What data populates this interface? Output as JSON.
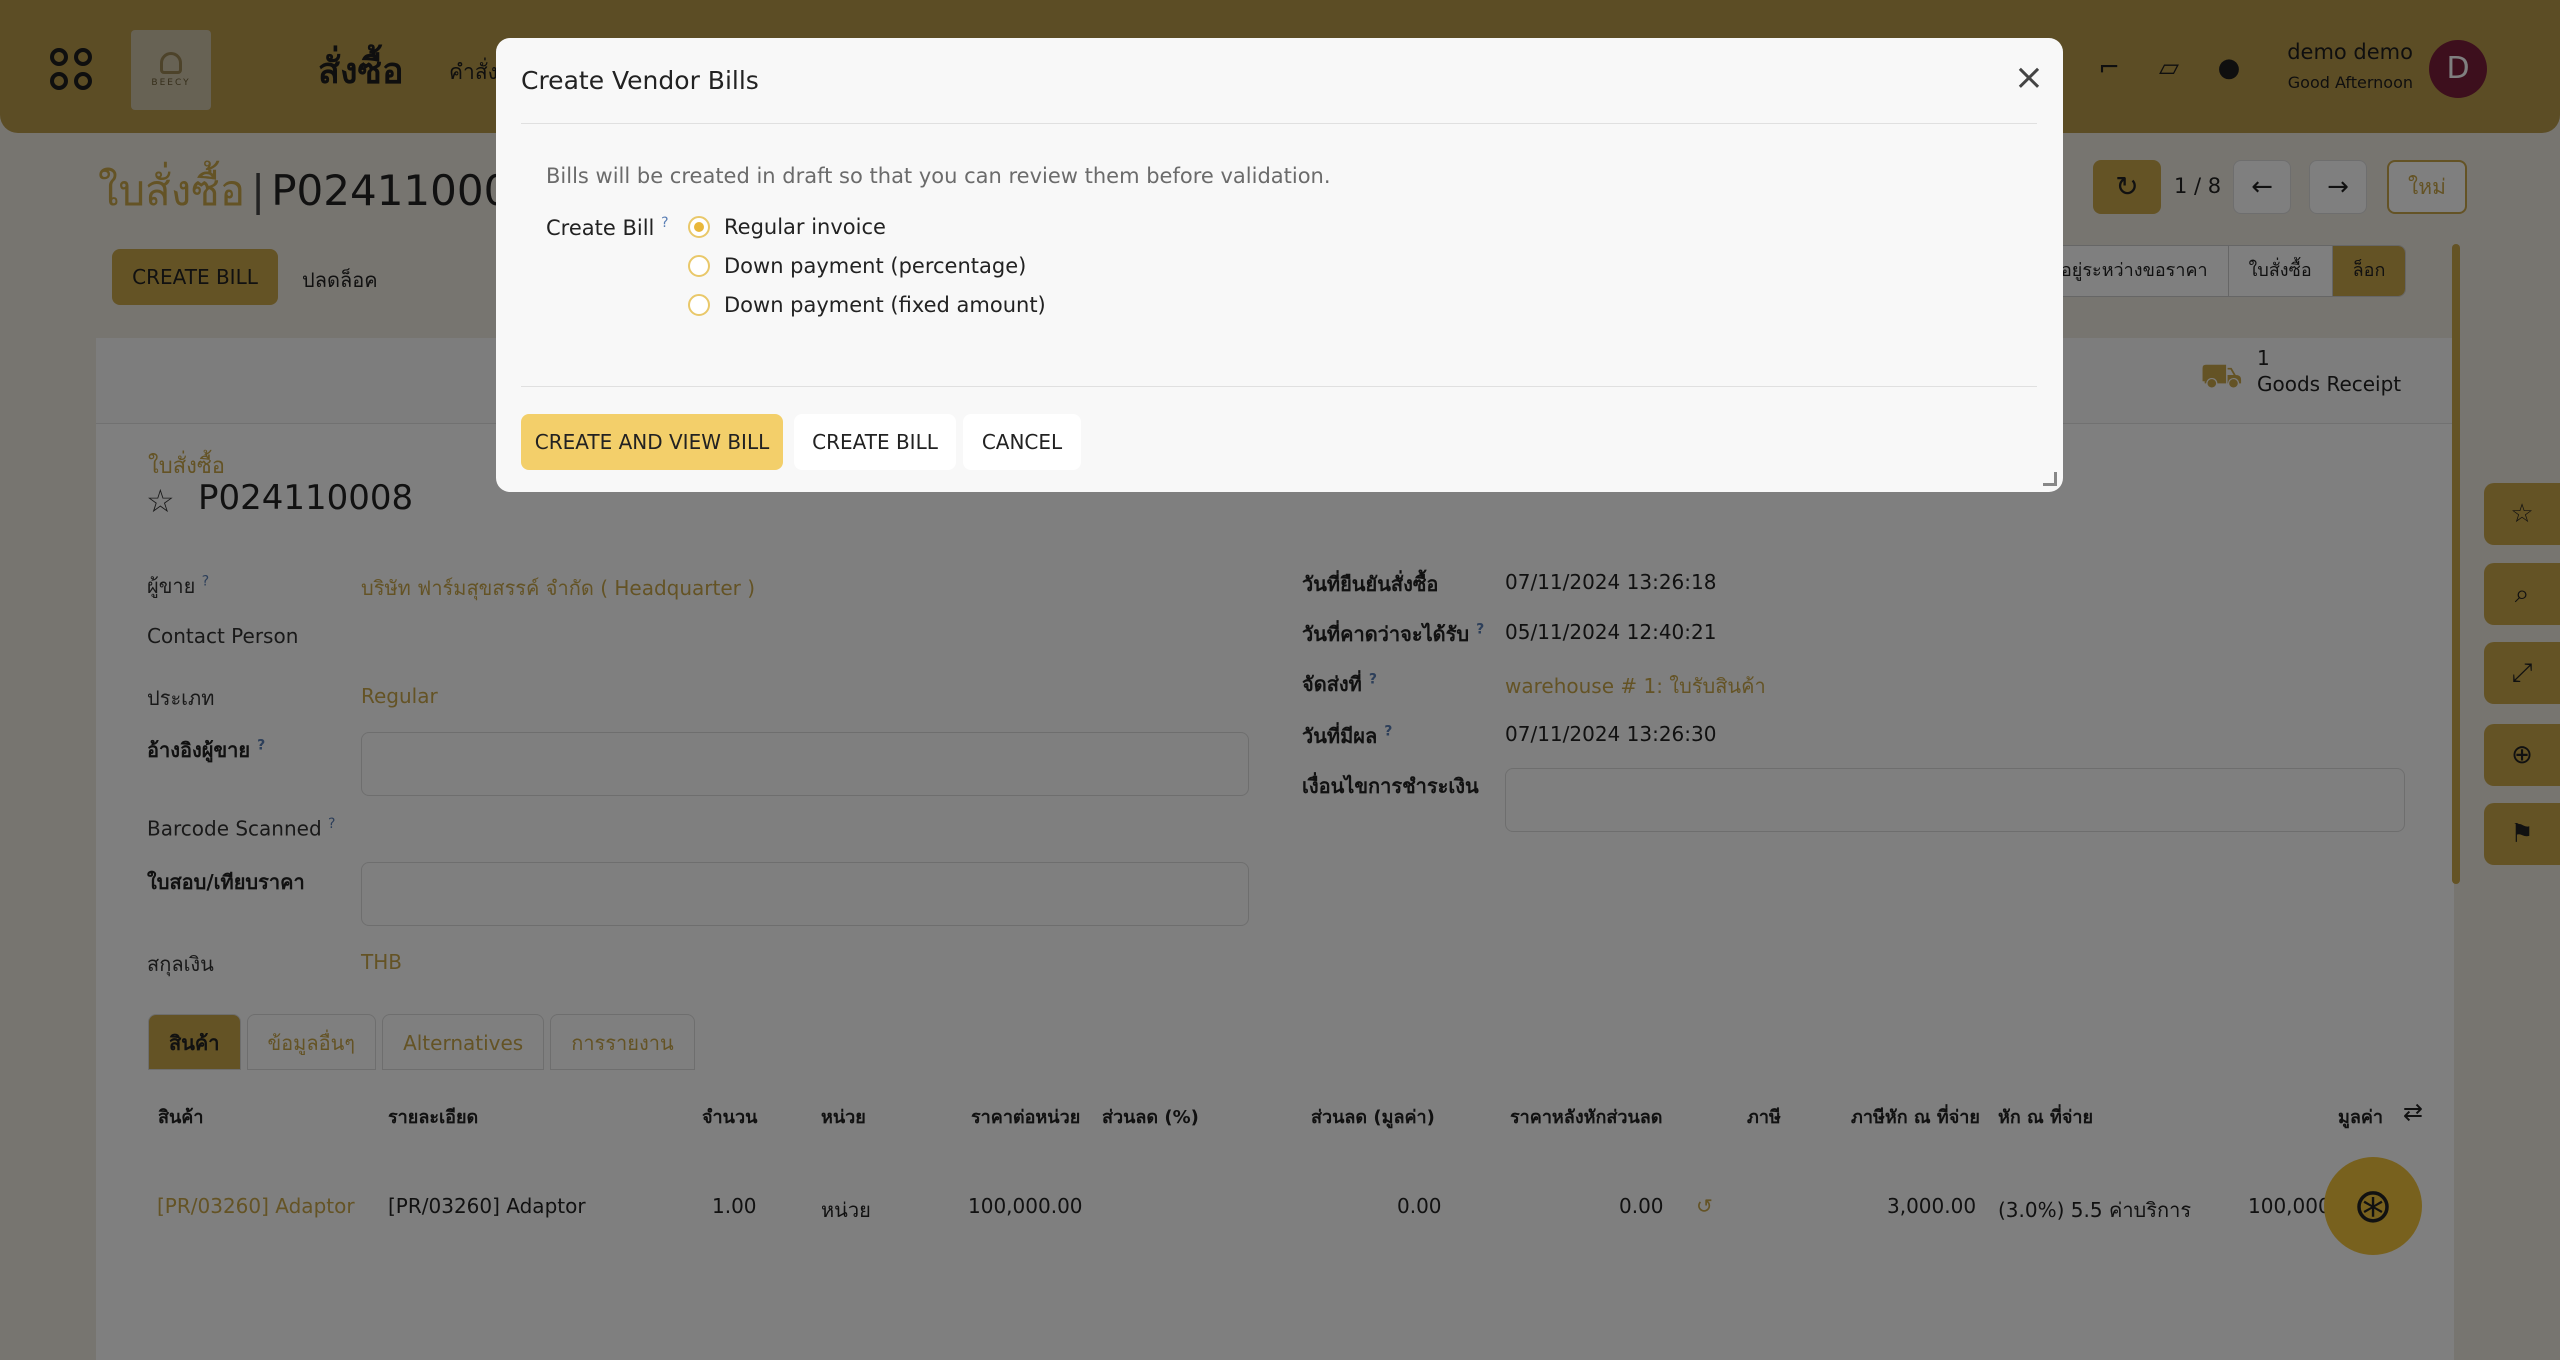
{
  "topbar": {
    "app_title": "สั่งซื้อ",
    "menu_item": "คำสั่ง",
    "logo_text": "BEECY",
    "user_name": "demo demo",
    "user_greeting": "Good Afternoon",
    "avatar_letter": "D",
    "icons": [
      "apps-icon",
      "paint-roller-icon",
      "note-icon",
      "lightbulb-icon"
    ]
  },
  "page": {
    "breadcrumb_parent": "ใบสั่งซื้อ",
    "breadcrumb_current": "P024110008",
    "pager_count": "1 / 8",
    "new_label": "ใหม่",
    "create_bill_label": "CREATE BILL",
    "unlock_label": "ปลดล็อค",
    "statuses": [
      {
        "label": "อยู่ระหว่างขอราคา",
        "active": false
      },
      {
        "label": "ใบสั่งซื้อ",
        "active": false
      },
      {
        "label": "ล็อก",
        "active": true
      }
    ],
    "receipt_count": "1",
    "receipt_label": "Goods Receipt",
    "doc_kind": "ใบสั่งซื้อ",
    "doc_name": "P024110008",
    "fields_left": {
      "vendor_label": "ผู้ขาย",
      "vendor_value": "บริษัท ฟาร์มสุขสรรค์ จำกัด ( Headquarter )",
      "contact_label": "Contact Person",
      "type_label": "ประเภท",
      "type_value": "Regular",
      "vendor_ref_label": "อ้างอิงผู้ขาย",
      "barcode_label": "Barcode Scanned",
      "rfq_label": "ใบสอบ/เทียบราคา",
      "currency_label": "สกุลเงิน",
      "currency_value": "THB"
    },
    "fields_right": {
      "confirm_date_label": "วันที่ยืนยันสั่งซื้อ",
      "confirm_date_value": "07/11/2024 13:26:18",
      "expected_label": "วันที่คาดว่าจะได้รับ",
      "expected_value": "05/11/2024 12:40:21",
      "deliver_label": "จัดส่งที่",
      "deliver_value": "warehouse # 1: ใบรับสินค้า",
      "effective_label": "วันที่มีผล",
      "effective_value": "07/11/2024 13:26:30",
      "payment_terms_label": "เงื่อนไขการชำระเงิน"
    },
    "tabs": [
      {
        "label": "สินค้า",
        "active": true
      },
      {
        "label": "ข้อมูลอื่นๆ",
        "active": false
      },
      {
        "label": "Alternatives",
        "active": false
      },
      {
        "label": "การรายงาน",
        "active": false
      }
    ],
    "table": {
      "headers": [
        "สินค้า",
        "รายละเอียด",
        "จำนวน",
        "หน่วย",
        "ราคาต่อหน่วย",
        "ส่วนลด (%)",
        "ส่วนลด (มูลค่า)",
        "ราคาหลังหักส่วนลด",
        "ภาษี",
        "ภาษีหัก ณ ที่จ่าย",
        "หัก ณ ที่จ่าย",
        "มูลค่า"
      ],
      "row": [
        "[PR/03260] Adaptor",
        "[PR/03260] Adaptor",
        "1.00",
        "หน่วย",
        "100,000.00",
        "",
        "0.00",
        "0.00",
        "",
        "3,000.00",
        "(3.0%) 5.5 ค่าบริการ",
        "100,000"
      ]
    }
  },
  "modal": {
    "title": "Create Vendor Bills",
    "note": "Bills will be created in draft so that you can review them before validation.",
    "field_label": "Create Bill",
    "field_help": "?",
    "options": [
      {
        "label": "Regular invoice",
        "checked": true
      },
      {
        "label": "Down payment (percentage)",
        "checked": false
      },
      {
        "label": "Down payment (fixed amount)",
        "checked": false
      }
    ],
    "buttons": {
      "create_and_view": "CREATE AND VIEW BILL",
      "create": "CREATE BILL",
      "cancel": "CANCEL"
    }
  },
  "colors": {
    "topbar": "#b99a4b",
    "accent": "#c9a64a",
    "primary_button": "#f3cf6a",
    "avatar": "#7a1f3a"
  }
}
